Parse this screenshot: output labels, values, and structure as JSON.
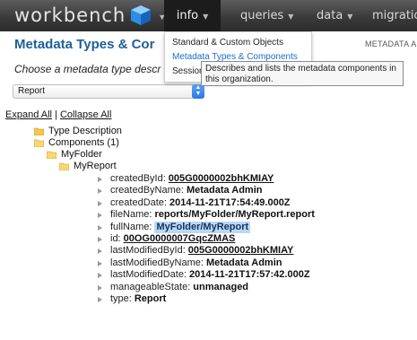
{
  "navbar": {
    "logo": "workbench",
    "items": [
      {
        "label": "info"
      },
      {
        "label": "queries"
      },
      {
        "label": "data"
      },
      {
        "label": "migratio"
      }
    ]
  },
  "page": {
    "title": "Metadata Types & Cor",
    "right_label": "METADATA A",
    "prompt": "Choose a metadata type descr",
    "select": {
      "value": "Report"
    },
    "expand_all": "Expand All",
    "separator": "|",
    "collapse_all": "Collapse All"
  },
  "menu": {
    "items": [
      {
        "label": "Standard & Custom Objects"
      },
      {
        "label": "Metadata Types & Components"
      },
      {
        "label": "Session"
      }
    ],
    "tooltip": "Describes and lists the metadata components in this organization."
  },
  "tree": {
    "type_description": "Type Description",
    "components": "Components (1)",
    "folder": "MyFolder",
    "report": "MyReport",
    "fields": [
      {
        "key": "createdById:",
        "value": "005G0000002bhKMIAY",
        "style": "link"
      },
      {
        "key": "createdByName:",
        "value": "Metadata Admin",
        "style": "bold"
      },
      {
        "key": "createdDate:",
        "value": "2014-11-21T17:54:49.000Z",
        "style": "bold"
      },
      {
        "key": "fileName:",
        "value": "reports/MyFolder/MyReport.report",
        "style": "bold"
      },
      {
        "key": "fullName:",
        "value": "MyFolder/MyReport",
        "style": "highlight"
      },
      {
        "key": "id:",
        "value": "00OG0000007GqcZMAS",
        "style": "link"
      },
      {
        "key": "lastModifiedById:",
        "value": "005G0000002bhKMIAY",
        "style": "link"
      },
      {
        "key": "lastModifiedByName:",
        "value": "Metadata Admin",
        "style": "bold"
      },
      {
        "key": "lastModifiedDate:",
        "value": "2014-11-21T17:57:42.000Z",
        "style": "bold"
      },
      {
        "key": "manageableState:",
        "value": "unmanaged",
        "style": "bold"
      },
      {
        "key": "type:",
        "value": "Report",
        "style": "bold"
      }
    ]
  }
}
